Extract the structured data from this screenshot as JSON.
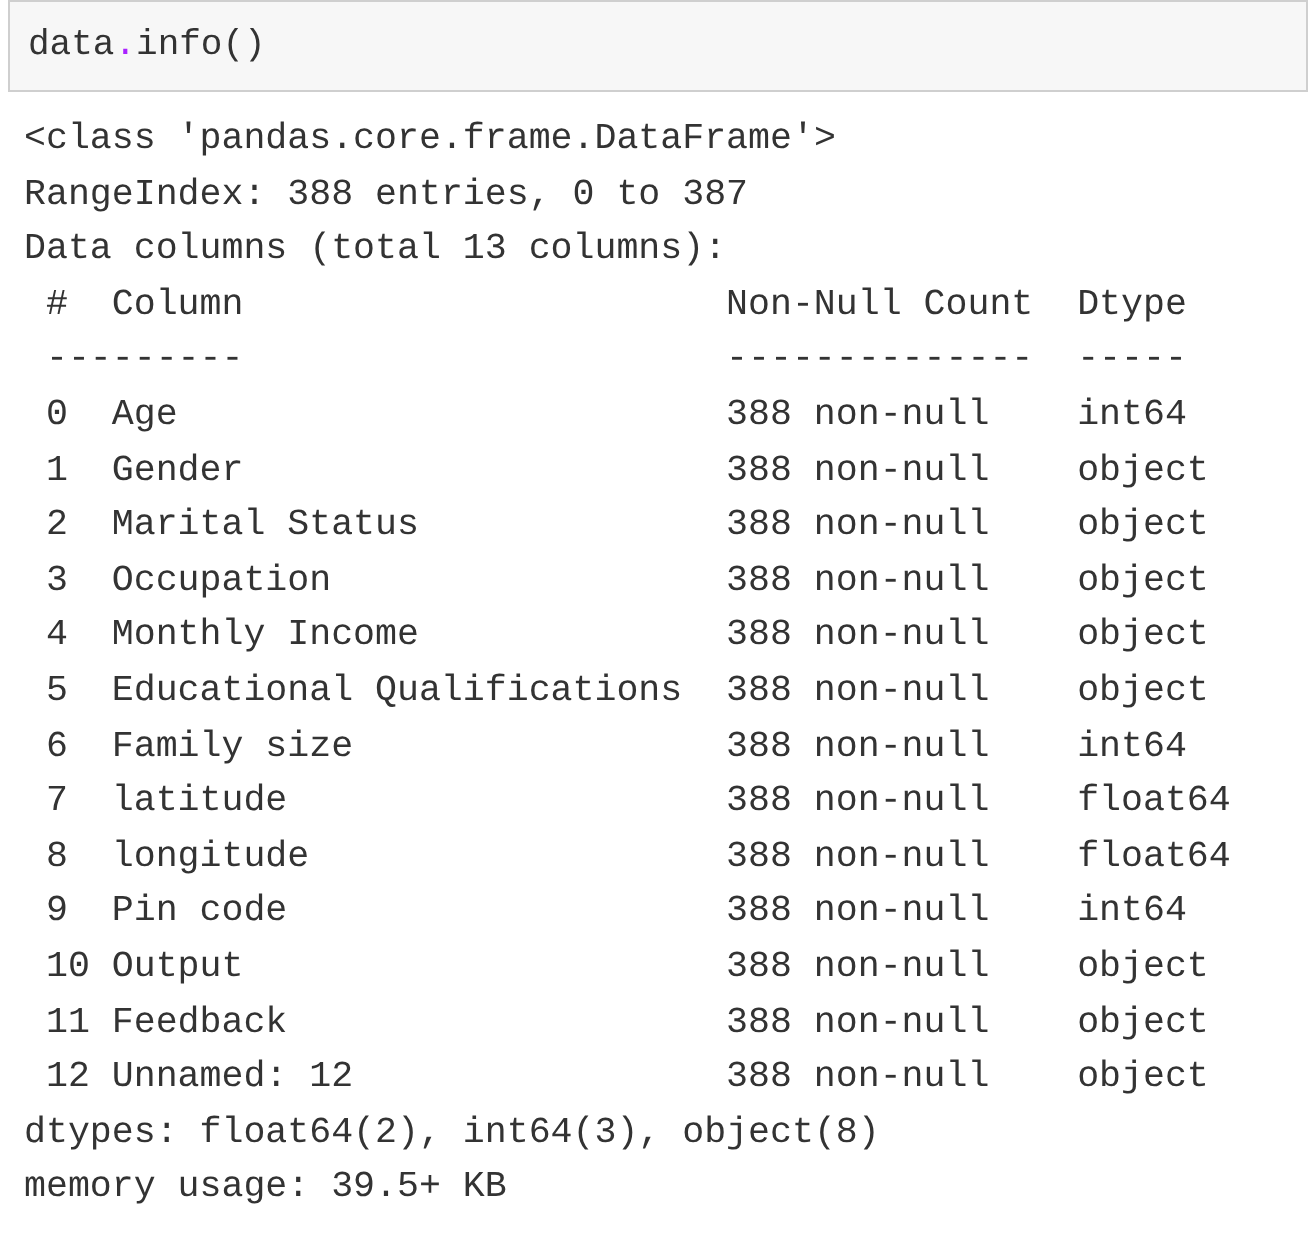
{
  "code_cell": {
    "tokens": [
      {
        "text": "data",
        "kind": "name"
      },
      {
        "text": ".",
        "kind": "operator"
      },
      {
        "text": "info()",
        "kind": "name"
      }
    ]
  },
  "output": {
    "header_lines": [
      "<class 'pandas.core.frame.DataFrame'>",
      "RangeIndex: 388 entries, 0 to 387",
      "Data columns (total 13 columns):"
    ],
    "table": {
      "columns": [
        "#",
        "Column",
        "Non-Null Count",
        "Dtype"
      ],
      "rules": [
        "---",
        "------",
        "--------------",
        "-----"
      ],
      "rows": [
        {
          "index": "0",
          "column": "Age",
          "count": "388 non-null",
          "dtype": "int64"
        },
        {
          "index": "1",
          "column": "Gender",
          "count": "388 non-null",
          "dtype": "object"
        },
        {
          "index": "2",
          "column": "Marital Status",
          "count": "388 non-null",
          "dtype": "object"
        },
        {
          "index": "3",
          "column": "Occupation",
          "count": "388 non-null",
          "dtype": "object"
        },
        {
          "index": "4",
          "column": "Monthly Income",
          "count": "388 non-null",
          "dtype": "object"
        },
        {
          "index": "5",
          "column": "Educational Qualifications",
          "count": "388 non-null",
          "dtype": "object"
        },
        {
          "index": "6",
          "column": "Family size",
          "count": "388 non-null",
          "dtype": "int64"
        },
        {
          "index": "7",
          "column": "latitude",
          "count": "388 non-null",
          "dtype": "float64"
        },
        {
          "index": "8",
          "column": "longitude",
          "count": "388 non-null",
          "dtype": "float64"
        },
        {
          "index": "9",
          "column": "Pin code",
          "count": "388 non-null",
          "dtype": "int64"
        },
        {
          "index": "10",
          "column": "Output",
          "count": "388 non-null",
          "dtype": "object"
        },
        {
          "index": "11",
          "column": "Feedback",
          "count": "388 non-null",
          "dtype": "object"
        },
        {
          "index": "12",
          "column": "Unnamed: 12",
          "count": "388 non-null",
          "dtype": "object"
        }
      ]
    },
    "footer_lines": [
      "dtypes: float64(2), int64(3), object(8)",
      "memory usage: 39.5+ KB"
    ]
  }
}
